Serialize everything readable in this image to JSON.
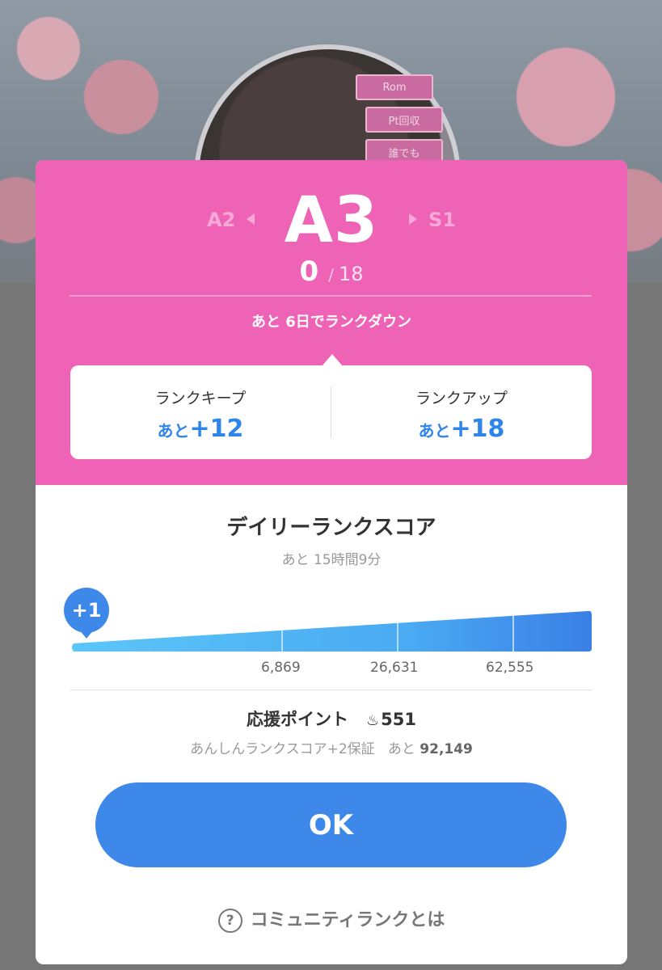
{
  "background": {
    "tags": [
      "Rom",
      "Pt回収",
      "誰でも"
    ]
  },
  "rank": {
    "previous": "A2",
    "current": "A3",
    "next": "S1",
    "progress_current": "0",
    "progress_separator": "/",
    "progress_max": "18",
    "rankdown_notice": "あと 6日でランクダウン"
  },
  "targets": {
    "keep_label": "ランクキープ",
    "keep_prefix": "あと",
    "keep_value": "+12",
    "up_label": "ランクアップ",
    "up_prefix": "あと",
    "up_value": "+18"
  },
  "daily": {
    "title": "デイリーランクスコア",
    "remaining": "あと 15時間9分",
    "current_badge": "+1",
    "progress_fraction": 0.0,
    "ticks": [
      "6,869",
      "26,631",
      "62,555"
    ]
  },
  "support": {
    "label": "応援ポイント",
    "icon": "drop-icon",
    "value": "551",
    "guarantee_label": "あんしんランクスコア+2保証",
    "guarantee_prefix": "あと",
    "guarantee_value": "92,149"
  },
  "buttons": {
    "ok": "OK",
    "help": "コミュニティランクとは"
  },
  "colors": {
    "pink": "#ee63b6",
    "accent_blue": "#3d88e9",
    "value_blue": "#2f86e8"
  }
}
